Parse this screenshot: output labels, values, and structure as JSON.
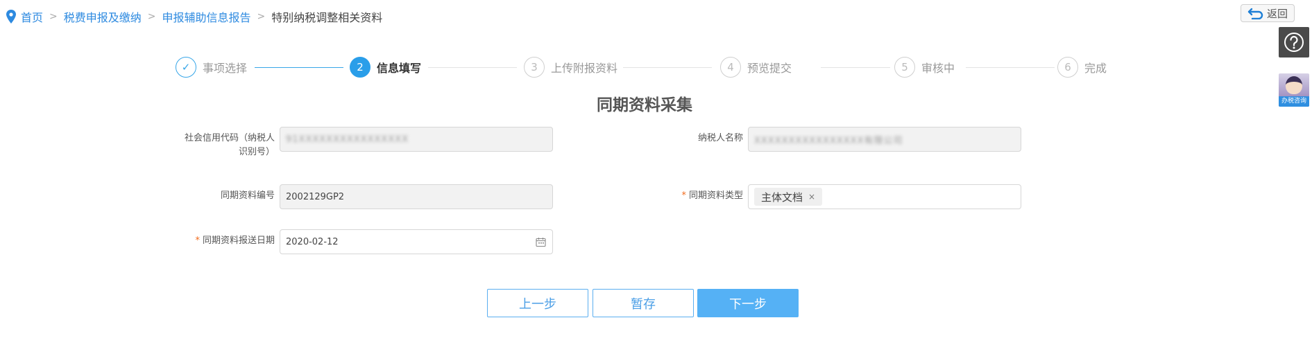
{
  "breadcrumb": {
    "home": "首页",
    "level1": "税费申报及缴纳",
    "level2": "申报辅助信息报告",
    "current": "特别纳税调整相关资料",
    "separator": ">"
  },
  "back_label": "返回",
  "assistant_label": "办税咨询",
  "steps": [
    {
      "number": "✓",
      "label": "事项选择",
      "status": "done"
    },
    {
      "number": "2",
      "label": "信息填写",
      "status": "active"
    },
    {
      "number": "3",
      "label": "上传附报资料",
      "status": "pending"
    },
    {
      "number": "4",
      "label": "预览提交",
      "status": "pending"
    },
    {
      "number": "5",
      "label": "审核中",
      "status": "pending"
    },
    {
      "number": "6",
      "label": "完成",
      "status": "pending"
    }
  ],
  "form": {
    "title": "同期资料采集",
    "credit_code": {
      "label_line1": "社会信用代码（纳税人",
      "label_line2": "识别号）",
      "value": "91XXXXXXXXXXXXXXXX"
    },
    "taxpayer_name": {
      "label": "纳税人名称",
      "value": "XXXXXXXXXXXXXXXX有限公司"
    },
    "doc_number": {
      "label": "同期资料编号",
      "value": "2002129GP2"
    },
    "doc_type": {
      "label": "同期资料类型",
      "required": "*",
      "tag": "主体文档",
      "remove": "×"
    },
    "submit_date": {
      "label": "同期资料报送日期",
      "required": "*",
      "value": "2020-02-12"
    }
  },
  "buttons": {
    "prev": "上一步",
    "save": "暂存",
    "next": "下一步"
  },
  "colors": {
    "accent": "#2a9ee9",
    "required": "#f26b1d",
    "primary_button": "#55b1f5"
  }
}
